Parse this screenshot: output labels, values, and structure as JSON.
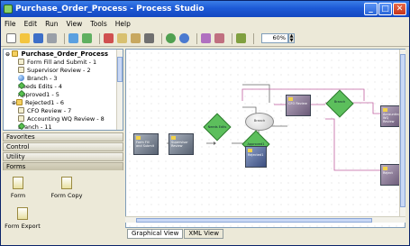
{
  "window": {
    "title": "Purchase_Order_Process - Process Studio"
  },
  "menu": [
    "File",
    "Edit",
    "Run",
    "View",
    "Tools",
    "Help"
  ],
  "toolbar": {
    "zoom": "60%"
  },
  "tree": {
    "root": "Purchase_Order_Process",
    "items": [
      {
        "label": "Form Fill and Submit - 1",
        "icon": "document-icon"
      },
      {
        "label": "Supervisor Review - 2",
        "icon": "document-icon"
      },
      {
        "label": "Branch - 3",
        "icon": "sphere-icon"
      },
      {
        "label": "Needs Edits - 4",
        "icon": "diamond-icon"
      },
      {
        "label": "Approved1 - 5",
        "icon": "diamond-icon"
      },
      {
        "label": "Rejected1 - 6",
        "icon": "folder-icon"
      },
      {
        "label": "CFO Review - 7",
        "icon": "document-icon"
      },
      {
        "label": "Accounting WQ Review - 8",
        "icon": "document-icon"
      },
      {
        "label": "Branch - 11",
        "icon": "diamond-icon"
      }
    ]
  },
  "accordion": [
    "Favorites",
    "Control",
    "Utility",
    "Forms"
  ],
  "forms": {
    "items": [
      "Form",
      "Form Copy",
      "Form Export"
    ]
  },
  "tabs": [
    "Graphical View",
    "XML View"
  ],
  "diagram": {
    "nodes": [
      "Form Fill and Submit",
      "Supervisor Review",
      "Needs Edits",
      "Branch",
      "Approved1",
      "CFO Review",
      "Accounting WQ Review",
      "Rejected1",
      "Branch",
      "Reject"
    ]
  },
  "colors": {
    "titlebar": "#1d5ad6",
    "canvas": "#ffffff",
    "link_pink": "#c060a0",
    "task": "#596373",
    "decision": "#5cbf5c"
  }
}
